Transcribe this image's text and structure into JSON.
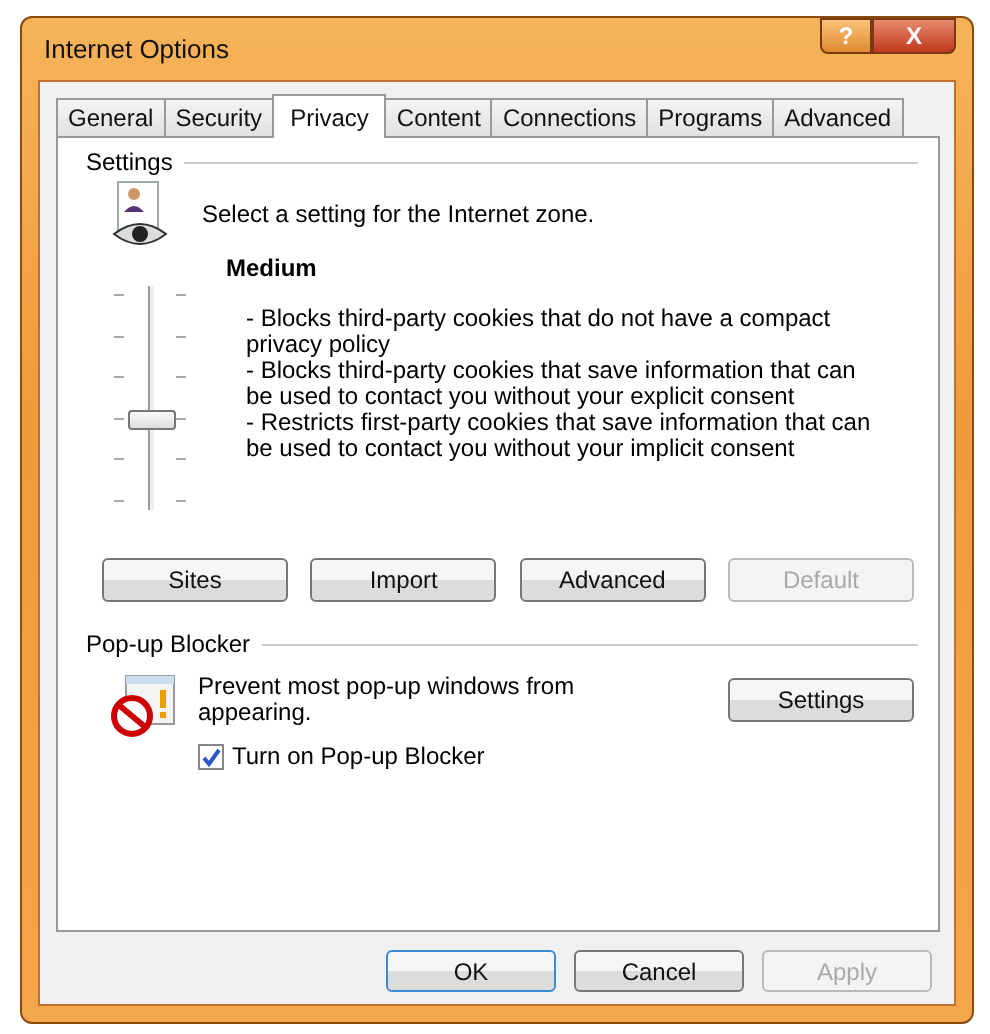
{
  "window": {
    "title": "Internet Options",
    "buttons": [
      {
        "kind": "help",
        "label": "?"
      },
      {
        "kind": "close",
        "label": "X"
      }
    ]
  },
  "tabs": [
    {
      "label": "General",
      "selected": false
    },
    {
      "label": "Security",
      "selected": false
    },
    {
      "label": "Privacy",
      "selected": true
    },
    {
      "label": "Content",
      "selected": false
    },
    {
      "label": "Connections",
      "selected": false
    },
    {
      "label": "Programs",
      "selected": false
    },
    {
      "label": "Advanced",
      "selected": false
    }
  ],
  "settings": {
    "heading": "Settings",
    "intro": "Select a setting for the Internet zone.",
    "slider": {
      "level": 0.4
    },
    "level_name": "Medium",
    "description": [
      "- Blocks third-party cookies that do not have a compact privacy policy",
      "- Blocks third-party cookies that save information that can be used to contact you without your explicit consent",
      "- Restricts first-party cookies that save information that can be used to contact you without your implicit consent"
    ],
    "buttons": [
      {
        "label": "Sites",
        "disabled": false
      },
      {
        "label": "Import",
        "disabled": false
      },
      {
        "label": "Advanced",
        "disabled": false
      },
      {
        "label": "Default",
        "disabled": true
      }
    ]
  },
  "popup_blocker": {
    "heading": "Pop-up Blocker",
    "text": "Prevent most pop-up windows from appearing.",
    "button": {
      "label": "Settings",
      "disabled": false
    },
    "checkbox": {
      "label": "Turn on Pop-up Blocker",
      "checked": true
    }
  },
  "footer_buttons": [
    {
      "label": "OK",
      "disabled": false,
      "default": true
    },
    {
      "label": "Cancel",
      "disabled": false,
      "default": false
    },
    {
      "label": "Apply",
      "disabled": true,
      "default": false
    }
  ]
}
